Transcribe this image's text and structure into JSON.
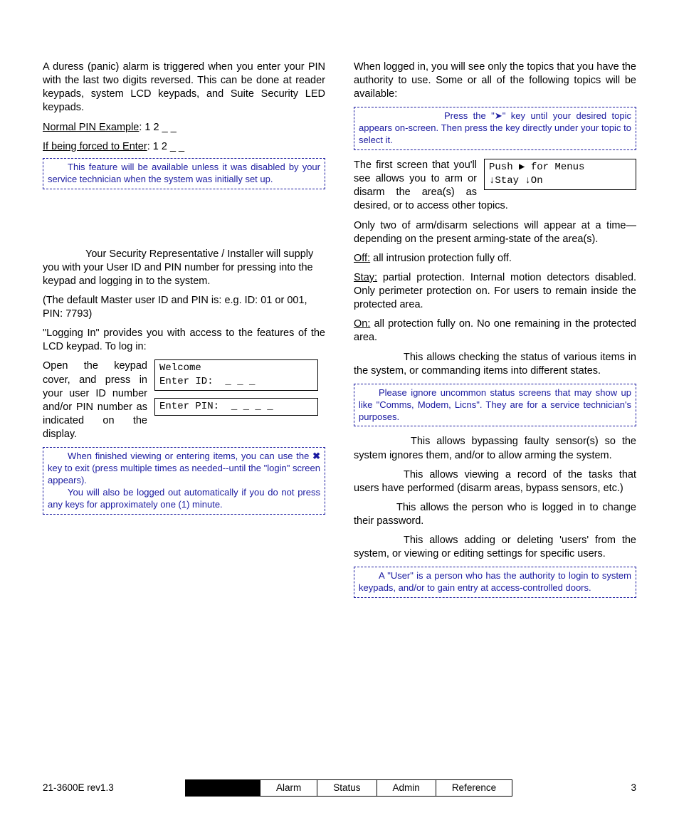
{
  "left": {
    "p1": "A duress (panic) alarm is triggered when you enter your PIN with the last two digits reversed.  This can be done at reader keypads, system LCD keypads, and Suite Security LED keypads.",
    "normal_label": "Normal PIN Example",
    "normal_val": ":  1 2 _ _",
    "forced_label": "If being forced to Enter",
    "forced_val": ":  1 2 _ _",
    "note1": "This feature will be available unless it was disabled by your service technician when the system was initially set up.",
    "p2a": "Your Security Representative / Installer will supply you with your User ID and PIN number for pressing into the keypad and logging in to the system.",
    "p2b": "(The default Master user ID and PIN is: e.g. ID: 01 or 001, PIN: 7793)",
    "p2c": "\"Logging In\" provides you with access to the features of the LCD keypad. To log in:",
    "p3": "Open the keypad cover, and press in your user ID number and/or PIN number as indicated on the display.",
    "lcd1a": "Welcome",
    "lcd1b": "Enter ID:  _ _ _",
    "lcd2": "Enter PIN:  _ _ _ _",
    "note2a": "When finished viewing or entering items, you can use the ",
    "note2x": "✖",
    "note2b": " key to exit (press multiple times as needed--until the \"login\" screen appears).",
    "note2c": "You will also be logged out automatically if you do not press any keys for approximately one (1) minute."
  },
  "right": {
    "p1": "When logged in, you will see only the topics that you have the authority to use.  Some or all of the following topics will be available:",
    "note1a": "Press the \"",
    "note1arrow": "➤",
    "note1b": "\" key until your desired topic appears on-screen.  Then press the key directly under your topic to select it.",
    "lcd1a": "Push ▶ for Menus",
    "lcd1b": "     ↓Stay   ↓On",
    "p2": "The first screen that you'll see allows you to arm or disarm the area(s) as desired, or to access other topics.",
    "p3": "Only two of arm/disarm selections will appear at a time—depending on the present arming-state of the area(s).",
    "off_label": "Off:",
    "off_txt": " all intrusion protection fully off.",
    "stay_label": "Stay:",
    "stay_txt": " partial protection. Internal motion detectors disabled. Only perimeter protection on. For users to remain inside the protected area.",
    "on_label": "On:",
    "on_txt": " all protection fully on. No one remaining in the protected area.",
    "p4": "This allows checking the status of various items in the system, or commanding items into different states.",
    "note2": "Please ignore uncommon status screens that may show up like \"Comms, Modem, Licns\". They are for a service technician's purposes.",
    "p5": "This allows bypassing faulty sensor(s) so the system ignores them, and/or to allow arming the system.",
    "p6": "This allows viewing a record of the tasks that users have performed (disarm areas, bypass sensors, etc.)",
    "p7": "This allows the person who is logged in to change their password.",
    "p8": "This allows adding or deleting 'users' from the system, or viewing or editing settings for specific users.",
    "note3": "A \"User\" is a person who has the authority to login to system keypads, and/or to gain entry at access-controlled doors."
  },
  "footer": {
    "rev": "21-3600E rev1.3",
    "tabs": [
      "",
      "Alarm",
      "Status",
      "Admin",
      "Reference"
    ],
    "page": "3"
  }
}
